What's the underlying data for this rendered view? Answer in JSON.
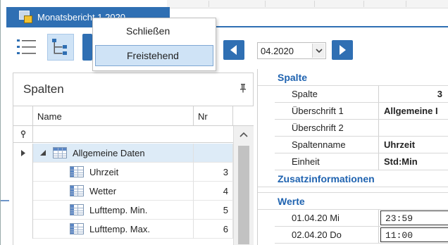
{
  "window": {
    "title": "Monatsbericht 1 2020",
    "title_color": "#2f6fb3"
  },
  "context_menu": {
    "items": [
      {
        "label": "Schließen"
      },
      {
        "label": "Freistehend",
        "highlighted": true
      }
    ]
  },
  "toolbar": {
    "list_view_icon": "list-icon",
    "tree_view_icon": "tree-icon",
    "prev_icon": "arrow-left-icon",
    "next_icon": "arrow-right-icon",
    "month_value": "04.2020",
    "accent_color": "#2f6fb3"
  },
  "columns_panel": {
    "title": "Spalten",
    "headers": {
      "name": "Name",
      "nr": "Nr"
    },
    "rows": [
      {
        "label": "Allgemeine Daten",
        "nr": "",
        "group": true
      },
      {
        "label": "Uhrzeit",
        "nr": "3"
      },
      {
        "label": "Wetter",
        "nr": "4"
      },
      {
        "label": "Lufttemp. Min.",
        "nr": "5"
      },
      {
        "label": "Lufttemp. Max.",
        "nr": "6"
      }
    ]
  },
  "properties_panel": {
    "categories": {
      "spalte": "Spalte",
      "zusatz": "Zusatzinformationen",
      "werte": "Werte"
    },
    "spalte_rows": [
      {
        "key": "Spalte",
        "value": "3"
      },
      {
        "key": "Überschrift 1",
        "value": "Allgemeine I"
      },
      {
        "key": "Überschrift 2",
        "value": ""
      },
      {
        "key": "Spaltenname",
        "value": "Uhrzeit"
      },
      {
        "key": "Einheit",
        "value": "Std:Min"
      }
    ],
    "werte_rows": [
      {
        "key": "01.04.20 Mi",
        "value": "23:59"
      },
      {
        "key": "02.04.20 Do",
        "value": "11:00"
      }
    ],
    "category_color": "#1f63b0"
  }
}
